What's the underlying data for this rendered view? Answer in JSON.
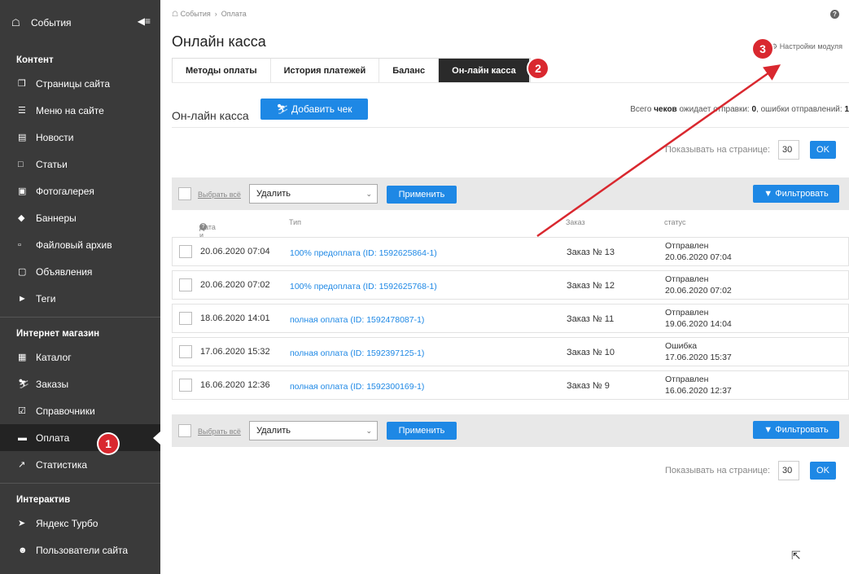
{
  "sidebar": {
    "top_label": "События",
    "sections": [
      {
        "title": "Контент",
        "items": [
          {
            "label": "Страницы сайта",
            "icon": "pages-icon"
          },
          {
            "label": "Меню на сайте",
            "icon": "menu-icon"
          },
          {
            "label": "Новости",
            "icon": "news-icon"
          },
          {
            "label": "Статьи",
            "icon": "article-icon"
          },
          {
            "label": "Фотогалерея",
            "icon": "gallery-icon"
          },
          {
            "label": "Баннеры",
            "icon": "banner-icon"
          },
          {
            "label": "Файловый архив",
            "icon": "folder-icon"
          },
          {
            "label": "Объявления",
            "icon": "ads-icon"
          },
          {
            "label": "Теги",
            "icon": "tag-icon"
          }
        ]
      },
      {
        "title": "Интернет магазин",
        "items": [
          {
            "label": "Каталог",
            "icon": "catalog-icon"
          },
          {
            "label": "Заказы",
            "icon": "cart-icon"
          },
          {
            "label": "Справочники",
            "icon": "check-icon"
          },
          {
            "label": "Оплата",
            "icon": "payment-icon"
          },
          {
            "label": "Статистика",
            "icon": "chart-icon"
          }
        ]
      },
      {
        "title": "Интерактив",
        "items": [
          {
            "label": "Яндекс Турбо",
            "icon": "rocket-icon"
          },
          {
            "label": "Пользователи сайта",
            "icon": "users-icon"
          }
        ]
      }
    ]
  },
  "breadcrumb": {
    "home": "События",
    "sep": "›",
    "current": "Оплата"
  },
  "page_title": "Онлайн касса",
  "settings_link": "Настройки модуля",
  "tabs": [
    "Методы оплаты",
    "История платежей",
    "Баланс",
    "Он-лайн касса"
  ],
  "section_title": "Он-лайн касса",
  "add_button": "Добавить чек",
  "summary": {
    "prefix": "Всего ",
    "bold": "чеков",
    "mid": " ожидает отправки: ",
    "waiting": "0",
    "sep": ", ошибки отправлений: ",
    "errors": "1"
  },
  "per_page": {
    "label": "Показывать на странице:",
    "value": "30",
    "ok": "OK"
  },
  "actions": {
    "select_all": "Выбрать всё",
    "select_value": "Удалить",
    "apply": "Применить",
    "filter": "Фильтровать"
  },
  "columns": [
    "Дата и время",
    "Тип",
    "Заказ",
    "статус"
  ],
  "rows": [
    {
      "date": "20.06.2020 07:04",
      "type": "100% предоплата (ID: 1592625864-1)",
      "order": "Заказ № 13",
      "status": "Отправлен",
      "status_date": "20.06.2020 07:04"
    },
    {
      "date": "20.06.2020 07:02",
      "type": "100% предоплата (ID: 1592625768-1)",
      "order": "Заказ № 12",
      "status": "Отправлен",
      "status_date": "20.06.2020 07:02"
    },
    {
      "date": "18.06.2020 14:01",
      "type": "полная оплата (ID: 1592478087-1)",
      "order": "Заказ № 11",
      "status": "Отправлен",
      "status_date": "19.06.2020 14:04"
    },
    {
      "date": "17.06.2020 15:32",
      "type": "полная оплата (ID: 1592397125-1)",
      "order": "Заказ № 10",
      "status": "Ошибка",
      "status_date": "17.06.2020 15:37"
    },
    {
      "date": "16.06.2020 12:36",
      "type": "полная оплата (ID: 1592300169-1)",
      "order": "Заказ № 9",
      "status": "Отправлен",
      "status_date": "16.06.2020 12:37"
    }
  ],
  "badges": [
    "1",
    "2",
    "3"
  ],
  "colors": {
    "accent": "#1e88e5",
    "badge": "#d9282f",
    "sidebar": "#3a3a3a",
    "arrow": "#d9282f"
  }
}
